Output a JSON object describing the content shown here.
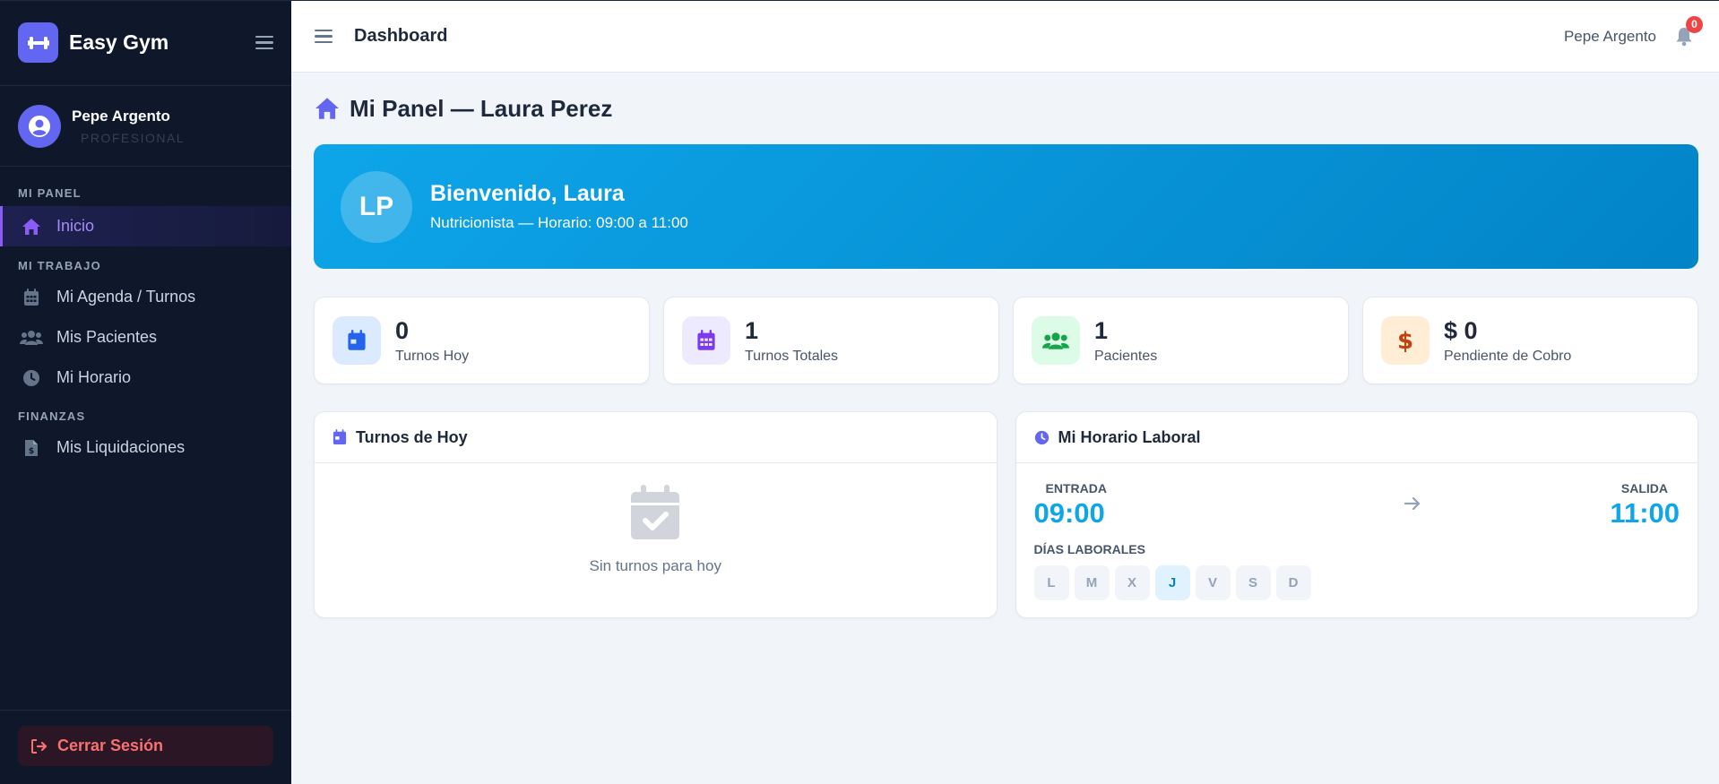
{
  "brand": {
    "name": "Easy Gym"
  },
  "user": {
    "name": "Pepe Argento",
    "role": "PROFESIONAL"
  },
  "nav": {
    "sections": [
      {
        "label": "MI PANEL",
        "items": [
          {
            "label": "Inicio",
            "icon": "home-icon",
            "active": true
          }
        ]
      },
      {
        "label": "MI TRABAJO",
        "items": [
          {
            "label": "Mi Agenda / Turnos",
            "icon": "calendar-icon"
          },
          {
            "label": "Mis Pacientes",
            "icon": "users-icon"
          },
          {
            "label": "Mi Horario",
            "icon": "clock-icon"
          }
        ]
      },
      {
        "label": "FINANZAS",
        "items": [
          {
            "label": "Mis Liquidaciones",
            "icon": "invoice-icon"
          }
        ]
      }
    ],
    "logout_label": "Cerrar Sesión"
  },
  "topbar": {
    "title": "Dashboard",
    "user": "Pepe Argento",
    "notifications": "0"
  },
  "page": {
    "title": "Mi Panel — Laura Perez",
    "welcome": {
      "initials": "LP",
      "title": "Bienvenido, Laura",
      "subtitle": "Nutricionista — Horario: 09:00 a 11:00"
    },
    "stats": [
      {
        "value": "0",
        "label": "Turnos Hoy",
        "icon": "calendar-icon",
        "bg": "#dbeafe",
        "fg": "#2563eb"
      },
      {
        "value": "1",
        "label": "Turnos Totales",
        "icon": "calendar-icon",
        "bg": "#ede9fe",
        "fg": "#7c3aed"
      },
      {
        "value": "1",
        "label": "Pacientes",
        "icon": "users-icon",
        "bg": "#dcfce7",
        "fg": "#16a34a"
      },
      {
        "value": "$ 0",
        "label": "Pendiente de Cobro",
        "icon": "dollar-icon",
        "bg": "#ffedd5",
        "fg": "#c2410c"
      }
    ],
    "today": {
      "title": "Turnos de Hoy",
      "empty": "Sin turnos para hoy"
    },
    "schedule": {
      "title": "Mi Horario Laboral",
      "entry_label": "ENTRADA",
      "entry": "09:00",
      "exit_label": "SALIDA",
      "exit": "11:00",
      "days_label": "DÍAS LABORALES",
      "days": [
        {
          "label": "L",
          "active": false
        },
        {
          "label": "M",
          "active": false
        },
        {
          "label": "X",
          "active": false
        },
        {
          "label": "J",
          "active": true
        },
        {
          "label": "V",
          "active": false
        },
        {
          "label": "S",
          "active": false
        },
        {
          "label": "D",
          "active": false
        }
      ]
    }
  },
  "colors": {
    "sidebar": "#0f172a",
    "accent": "#6366f1",
    "banner": "#0ea5e9",
    "danger": "#ef4444"
  }
}
